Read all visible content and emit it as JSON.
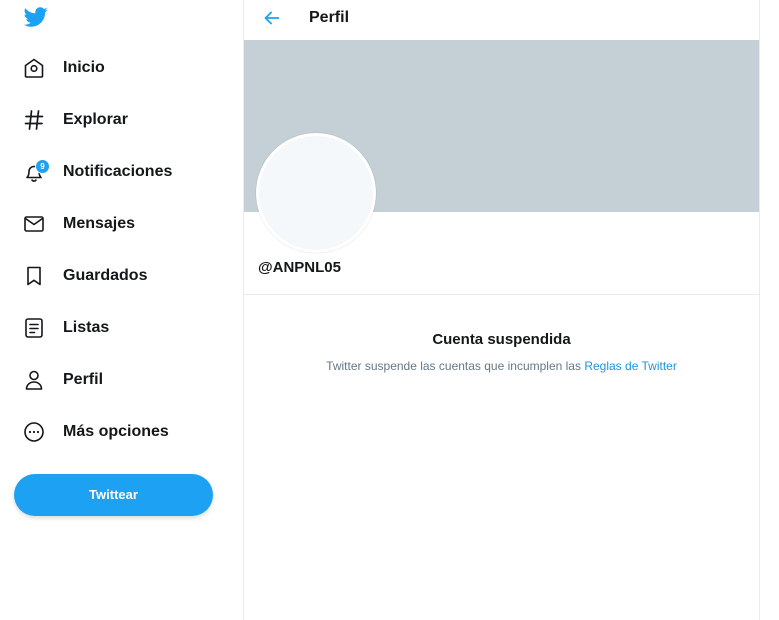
{
  "colors": {
    "accent": "#1da1f2",
    "banner": "#c4cfd6",
    "text_primary": "#14171a",
    "text_secondary": "#657786",
    "link": "#1b95e0"
  },
  "sidebar": {
    "logo_icon": "twitter-bird-icon",
    "items": [
      {
        "label": "Inicio",
        "icon": "home-icon"
      },
      {
        "label": "Explorar",
        "icon": "hashtag-icon"
      },
      {
        "label": "Notificaciones",
        "icon": "bell-icon",
        "badge": "9"
      },
      {
        "label": "Mensajes",
        "icon": "envelope-icon"
      },
      {
        "label": "Guardados",
        "icon": "bookmark-icon"
      },
      {
        "label": "Listas",
        "icon": "list-icon"
      },
      {
        "label": "Perfil",
        "icon": "person-icon"
      },
      {
        "label": "Más opciones",
        "icon": "more-circle-icon"
      }
    ],
    "tweet_button_label": "Twittear"
  },
  "header": {
    "back_icon": "back-arrow-icon",
    "title": "Perfil"
  },
  "profile": {
    "handle": "@ANPNL05"
  },
  "suspension": {
    "title": "Cuenta suspendida",
    "message": "Twitter suspende las cuentas que incumplen las ",
    "link_label": "Reglas de Twitter"
  }
}
